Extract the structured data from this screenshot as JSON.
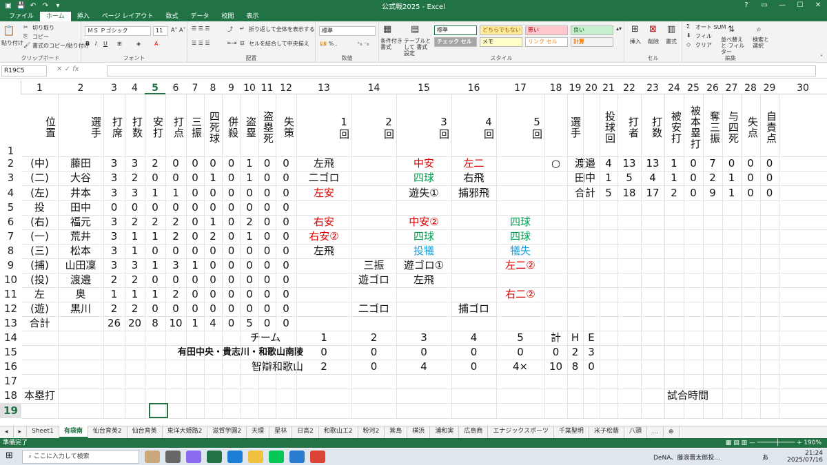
{
  "window": {
    "title": "公式戦2025 - Excel",
    "help": "?"
  },
  "ribbon_tabs": [
    "ファイル",
    "ホーム",
    "挿入",
    "ページ レイアウト",
    "数式",
    "データ",
    "校閲",
    "表示"
  ],
  "ribbon": {
    "paste": "貼り付け",
    "cut": "切り取り",
    "copy": "コピー",
    "format_painter": "書式のコピー/貼り付け",
    "clipboard": "クリップボード",
    "font_name": "ＭＳ Ｐゴシック",
    "font_size": "11",
    "font_group": "フォント",
    "wrap": "折り返して全体を表示する",
    "merge": "セルを結合して中央揃え",
    "align_group": "配置",
    "num_format": "標準",
    "num_group": "数値",
    "cond_format": "条件付き 書式",
    "table_format": "テーブルとして 書式設定",
    "styles": [
      "標準",
      "どちらでもない",
      "悪い",
      "良い",
      "チェック セル",
      "メモ",
      "リンク セル",
      "計算"
    ],
    "styles_group": "スタイル",
    "insert": "挿入",
    "delete": "削除",
    "format": "書式",
    "cells_group": "セル",
    "autosum": "オート SUM",
    "fill": "フィル",
    "clear": "クリア",
    "sort": "並べ替えと フィルター",
    "find": "検索と 選択",
    "edit_group": "編集"
  },
  "formula_bar": {
    "name_box": "R19C5",
    "fx": "fx"
  },
  "colors": {
    "excel_green": "#217346",
    "red": "#e00000",
    "green": "#00a050",
    "blue": "#1aa0e0"
  },
  "col_headers": [
    "1",
    "2",
    "3",
    "4",
    "5",
    "6",
    "7",
    "8",
    "9",
    "10",
    "11",
    "12",
    "13",
    "14",
    "15",
    "16",
    "17",
    "18",
    "19",
    "20",
    "21",
    "22",
    "23",
    "24",
    "25",
    "26",
    "27",
    "28",
    "29",
    "30"
  ],
  "row_headers": [
    "1",
    "2",
    "3",
    "4",
    "5",
    "6",
    "7",
    "8",
    "9",
    "10",
    "11",
    "12",
    "13",
    "14",
    "15",
    "16",
    "17",
    "18",
    "19"
  ],
  "header_labels": {
    "pos": "位置",
    "name": "選手",
    "pa": "打席",
    "ab": "打数",
    "h": "安打",
    "rbi": "打点",
    "so": "三振",
    "bbhbp": "四死球",
    "dp": "併殺",
    "sb": "盗塁",
    "cs": "盗塁死",
    "e": "失策",
    "i1": "1回",
    "i2": "2回",
    "i3": "3回",
    "i4": "4回",
    "i5": "5回",
    "p_name": "選手",
    "ip": "投球回",
    "bf": "打者",
    "pab": "打数",
    "ph": "被安打",
    "phr": "被本塁打",
    "pso": "奪三振",
    "pbb": "与四死",
    "r": "失点",
    "er": "自責点"
  },
  "batters": [
    {
      "pos": "(中)",
      "name": "藤田",
      "s": [
        "3",
        "3",
        "2",
        "0",
        "0",
        "0",
        "0",
        "1",
        "0",
        "0"
      ],
      "i": [
        [
          "左飛",
          ""
        ],
        [
          "",
          ""
        ],
        [
          "中安",
          "red"
        ],
        [
          "左二",
          "red"
        ],
        [
          "",
          ""
        ]
      ]
    },
    {
      "pos": "(二)",
      "name": "大谷",
      "s": [
        "3",
        "2",
        "0",
        "0",
        "0",
        "1",
        "0",
        "1",
        "0",
        "0"
      ],
      "i": [
        [
          "二ゴロ",
          ""
        ],
        [
          "",
          ""
        ],
        [
          "四球",
          "green"
        ],
        [
          "右飛",
          ""
        ],
        [
          "",
          ""
        ]
      ]
    },
    {
      "pos": "(左)",
      "name": "井本",
      "s": [
        "3",
        "3",
        "1",
        "1",
        "0",
        "0",
        "0",
        "0",
        "0",
        "0"
      ],
      "i": [
        [
          "左安",
          "red"
        ],
        [
          "",
          ""
        ],
        [
          "遊失①",
          ""
        ],
        [
          "捕邪飛",
          ""
        ],
        [
          "",
          ""
        ]
      ]
    },
    {
      "pos": "投",
      "name": "田中",
      "s": [
        "0",
        "0",
        "0",
        "0",
        "0",
        "0",
        "0",
        "0",
        "0",
        "0"
      ],
      "i": [
        [
          "",
          ""
        ],
        [
          "",
          ""
        ],
        [
          "",
          ""
        ],
        [
          "",
          ""
        ],
        [
          "",
          ""
        ]
      ]
    },
    {
      "pos": "(右)",
      "name": "福元",
      "s": [
        "3",
        "2",
        "2",
        "2",
        "0",
        "1",
        "0",
        "2",
        "0",
        "0"
      ],
      "i": [
        [
          "右安",
          "red"
        ],
        [
          "",
          ""
        ],
        [
          "中安②",
          "red"
        ],
        [
          "",
          ""
        ],
        [
          "四球",
          "green"
        ]
      ]
    },
    {
      "pos": "(一)",
      "name": "荒井",
      "s": [
        "3",
        "1",
        "1",
        "2",
        "0",
        "2",
        "0",
        "1",
        "0",
        "0"
      ],
      "i": [
        [
          "右安②",
          "red"
        ],
        [
          "",
          ""
        ],
        [
          "四球",
          "green"
        ],
        [
          "",
          ""
        ],
        [
          "四球",
          "green"
        ]
      ]
    },
    {
      "pos": "(三)",
      "name": "松本",
      "s": [
        "3",
        "1",
        "0",
        "0",
        "0",
        "0",
        "0",
        "0",
        "0",
        "0"
      ],
      "i": [
        [
          "左飛",
          ""
        ],
        [
          "",
          ""
        ],
        [
          "投犠",
          "blue"
        ],
        [
          "",
          ""
        ],
        [
          "犠失",
          "blue"
        ]
      ]
    },
    {
      "pos": "(捕)",
      "name": "山田凜",
      "s": [
        "3",
        "3",
        "1",
        "3",
        "1",
        "0",
        "0",
        "0",
        "0",
        "0"
      ],
      "i": [
        [
          "",
          ""
        ],
        [
          "三振",
          ""
        ],
        [
          "遊ゴロ①",
          ""
        ],
        [
          "",
          ""
        ],
        [
          "左二②",
          "red"
        ]
      ]
    },
    {
      "pos": "(投)",
      "name": "渡邉",
      "s": [
        "2",
        "2",
        "0",
        "0",
        "0",
        "0",
        "0",
        "0",
        "0",
        "0"
      ],
      "i": [
        [
          "",
          ""
        ],
        [
          "遊ゴロ",
          ""
        ],
        [
          "左飛",
          ""
        ],
        [
          "",
          ""
        ],
        [
          "",
          ""
        ]
      ]
    },
    {
      "pos": "左",
      "name": "奥",
      "s": [
        "1",
        "1",
        "1",
        "2",
        "0",
        "0",
        "0",
        "0",
        "0",
        "0"
      ],
      "i": [
        [
          "",
          ""
        ],
        [
          "",
          ""
        ],
        [
          "",
          ""
        ],
        [
          "",
          ""
        ],
        [
          "右二②",
          "red"
        ]
      ]
    },
    {
      "pos": "(遊)",
      "name": "黒川",
      "s": [
        "2",
        "2",
        "0",
        "0",
        "0",
        "0",
        "0",
        "0",
        "0",
        "0"
      ],
      "i": [
        [
          "",
          ""
        ],
        [
          "二ゴロ",
          ""
        ],
        [
          "",
          ""
        ],
        [
          "捕ゴロ",
          ""
        ],
        [
          "",
          ""
        ]
      ]
    }
  ],
  "total_row": {
    "label": "合計",
    "s": [
      "26",
      "20",
      "8",
      "10",
      "1",
      "4",
      "0",
      "5",
      "0",
      "0"
    ]
  },
  "pitchers": [
    {
      "mark": "○",
      "name": "渡邉",
      "s": [
        "4",
        "13",
        "13",
        "1",
        "0",
        "7",
        "0",
        "0",
        "0"
      ]
    },
    {
      "mark": "",
      "name": "田中",
      "s": [
        "1",
        "5",
        "4",
        "1",
        "0",
        "2",
        "1",
        "0",
        "0"
      ]
    },
    {
      "mark": "",
      "name": "合計",
      "s": [
        "5",
        "18",
        "17",
        "2",
        "0",
        "9",
        "1",
        "0",
        "0"
      ]
    }
  ],
  "linescore": {
    "team_label": "チーム",
    "headers": [
      "1",
      "2",
      "3",
      "4",
      "5",
      "計",
      "H",
      "E"
    ],
    "teams": [
      {
        "name": "有田中央・貴志川・和歌山南陵",
        "vals": [
          "0",
          "0",
          "0",
          "0",
          "0",
          "0",
          "2",
          "3"
        ]
      },
      {
        "name": "智辯和歌山",
        "vals": [
          "2",
          "0",
          "4",
          "0",
          "4×",
          "10",
          "8",
          "0"
        ]
      }
    ]
  },
  "footer_labels": {
    "hr": "本塁打",
    "time": "試合時間"
  },
  "sheet_tabs": [
    "Sheet1",
    "有袋南",
    "仙台育英2",
    "仙台育英",
    "東洋大姫路2",
    "滋賀学園2",
    "天理",
    "星林",
    "日高2",
    "和歌山工2",
    "粉河2",
    "箕島",
    "横浜",
    "浦和実",
    "広島商",
    "エナジックスポーツ",
    "千葉聖明",
    "米子松蔭",
    "八頭"
  ],
  "status": {
    "ready": "準備完了",
    "zoom": "190%"
  },
  "taskbar": {
    "search": "ここに入力して検索",
    "news": "DeNA、藤浪晋太郎投...",
    "time": "21:24",
    "date": "2025/07/16",
    "ime": "あ"
  }
}
